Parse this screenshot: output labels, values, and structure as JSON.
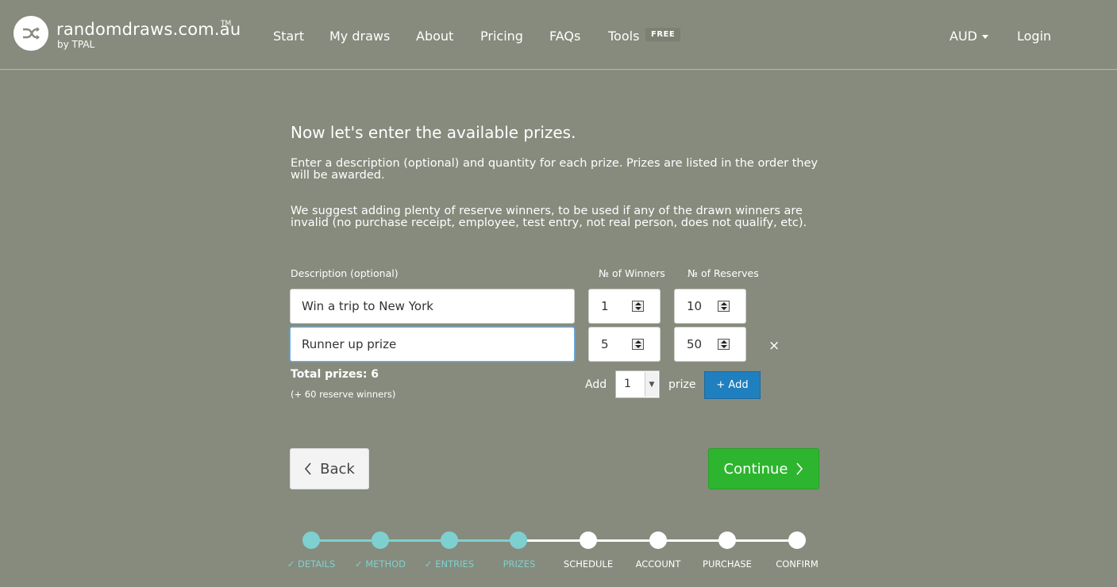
{
  "brand": {
    "name": "randomdraws.com.au",
    "tm": "TM",
    "sub": "by TPAL"
  },
  "nav": {
    "items": [
      "Start",
      "My draws",
      "About",
      "Pricing",
      "FAQs",
      "Tools"
    ],
    "free_badge": "FREE",
    "currency": "AUD",
    "login": "Login"
  },
  "content": {
    "heading": "Now let's enter the available prizes.",
    "para1": "Enter a description (optional) and quantity for each prize. Prizes are listed in the order they will be awarded.",
    "para2": "We suggest adding plenty of reserve winners, to be used if any of the drawn winners are invalid (no purchase receipt, employee, test entry, not real person, does not qualify, etc).",
    "col_description": "Description (optional)",
    "col_winners": "№ of Winners",
    "col_reserves": "№ of Reserves",
    "prizes": [
      {
        "description": "Win a trip to New York",
        "winners": "1",
        "reserves": "10"
      },
      {
        "description": "Runner up prize",
        "winners": "5",
        "reserves": "50"
      }
    ],
    "remove_symbol": "×",
    "total": "Total prizes: 6",
    "reserve_note": "(+ 60 reserve winners)",
    "add_label": "Add",
    "add_qty": "1",
    "prize_label": "prize",
    "add_button": "+ Add",
    "back_button": "Back",
    "continue_button": "Continue"
  },
  "progress": {
    "steps": [
      {
        "label": "✓ DETAILS",
        "done": true
      },
      {
        "label": "✓ METHOD",
        "done": true
      },
      {
        "label": "✓ ENTRIES",
        "done": true
      },
      {
        "label": "PRIZES",
        "done": true
      },
      {
        "label": "SCHEDULE",
        "done": false
      },
      {
        "label": "ACCOUNT",
        "done": false
      },
      {
        "label": "PURCHASE",
        "done": false
      },
      {
        "label": "CONFIRM",
        "done": false
      }
    ],
    "active_color": "#7ed0d0",
    "inactive_color": "#ffffff"
  },
  "colors": {
    "background": "#868b7d",
    "continue": "#2db52f",
    "add_button": "#1f7fbf"
  }
}
